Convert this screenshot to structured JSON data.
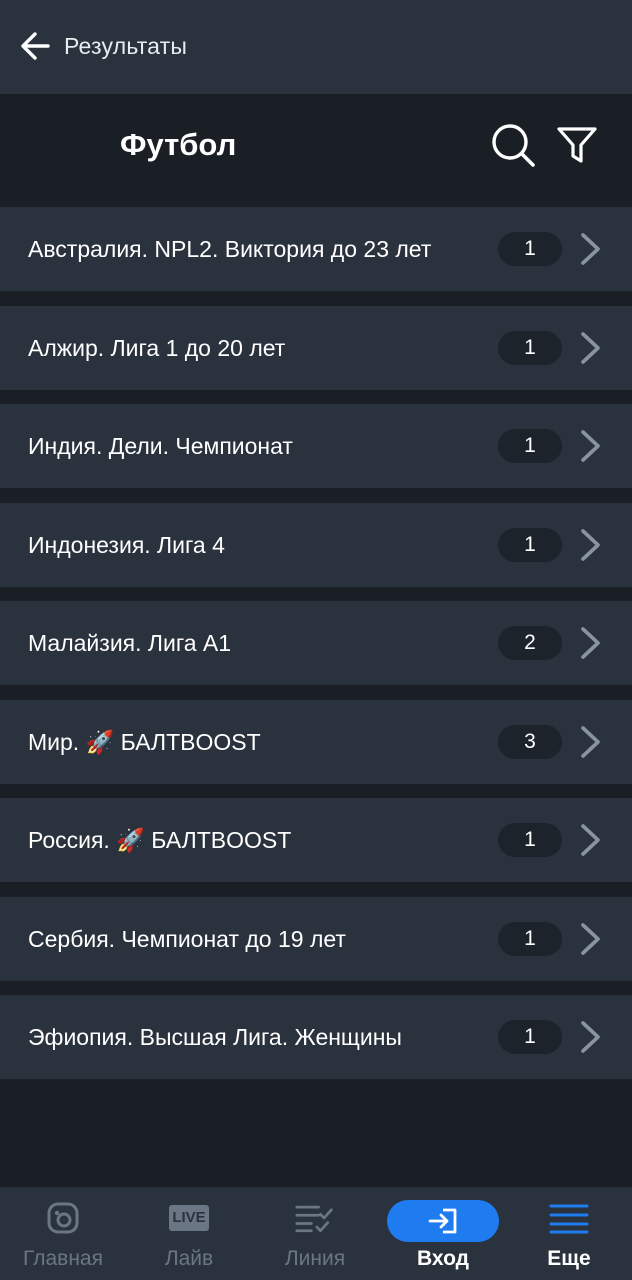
{
  "topbar": {
    "title": "Результаты"
  },
  "sport": {
    "title": "Футбол"
  },
  "leagues": [
    {
      "label": "Австралия. NPL2. Виктория до 23 лет",
      "count": "1"
    },
    {
      "label": "Алжир. Лига 1 до 20 лет",
      "count": "1"
    },
    {
      "label": "Индия. Дели. Чемпионат",
      "count": "1"
    },
    {
      "label": "Индонезия. Лига 4",
      "count": "1"
    },
    {
      "label": "Малайзия. Лига A1",
      "count": "2"
    },
    {
      "label": "Мир. 🚀 БАЛТBOOST",
      "count": "3"
    },
    {
      "label": "Россия. 🚀 БАЛТBOOST",
      "count": "1"
    },
    {
      "label": "Сербия. Чемпионат до 19 лет",
      "count": "1"
    },
    {
      "label": "Эфиопия. Высшая Лига. Женщины",
      "count": "1"
    }
  ],
  "nav": {
    "home": "Главная",
    "live": "Лайв",
    "live_icon_text": "LIVE",
    "line": "Линия",
    "login": "Вход",
    "more": "Еще"
  },
  "icons": {
    "back": "arrow-left-icon",
    "search": "search-icon",
    "filter": "filter-icon",
    "chevron": "chevron-right-icon"
  },
  "colors": {
    "background": "#1a1f26",
    "surface": "#2a323d",
    "badge": "#1d232b",
    "accent": "#1e7bf0",
    "inactive": "#6b7684"
  }
}
